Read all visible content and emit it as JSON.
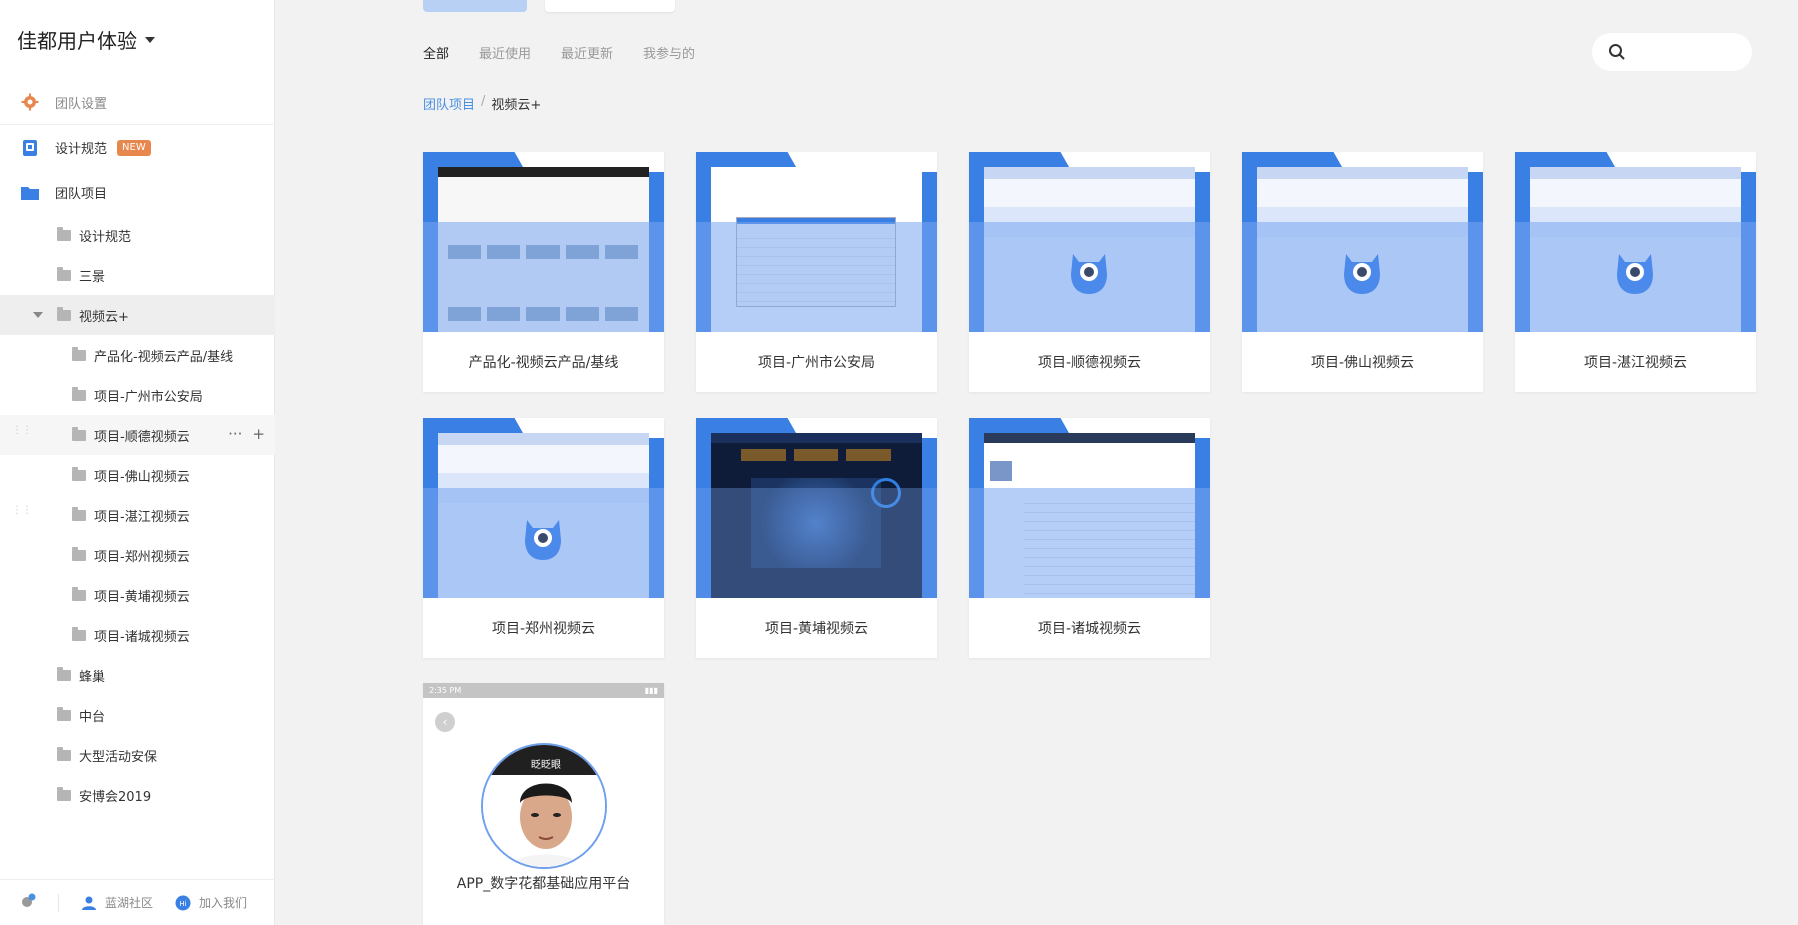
{
  "sidebar": {
    "team_title": "佳都用户体验",
    "nav": [
      {
        "label": "团队设置"
      },
      {
        "label": "设计规范",
        "badge": "NEW"
      },
      {
        "label": "团队项目"
      }
    ],
    "tree": [
      {
        "label": "设计规范"
      },
      {
        "label": "三景"
      },
      {
        "label": "视频云+"
      },
      {
        "label": "产品化-视频云产品/基线"
      },
      {
        "label": "项目-广州市公安局"
      },
      {
        "label": "项目-顺德视频云"
      },
      {
        "label": "项目-佛山视频云"
      },
      {
        "label": "项目-湛江视频云"
      },
      {
        "label": "项目-郑州视频云"
      },
      {
        "label": "项目-黄埔视频云"
      },
      {
        "label": "项目-诸城视频云"
      },
      {
        "label": "蜂巢"
      },
      {
        "label": "中台"
      },
      {
        "label": "大型活动安保"
      },
      {
        "label": "安博会2019"
      }
    ],
    "footer": {
      "community": "蓝湖社区",
      "join": "加入我们"
    }
  },
  "filters": {
    "tabs": [
      "全部",
      "最近使用",
      "最近更新",
      "我参与的"
    ],
    "active": "全部"
  },
  "search": {
    "placeholder": ""
  },
  "breadcrumb": {
    "parent": "团队项目",
    "separator": "/",
    "current": "视频云+"
  },
  "projects": [
    {
      "name": "产品化-视频云产品/基线"
    },
    {
      "name": "项目-广州市公安局"
    },
    {
      "name": "项目-顺德视频云"
    },
    {
      "name": "项目-佛山视频云"
    },
    {
      "name": "项目-湛江视频云"
    },
    {
      "name": "项目-郑州视频云"
    },
    {
      "name": "项目-黄埔视频云"
    },
    {
      "name": "项目-诸城视频云"
    }
  ],
  "app_card": {
    "time": "2:35 PM",
    "avatar_caption": "眨眨眼",
    "name": "APP_数字花都基础应用平台"
  },
  "colors": {
    "accent": "#4a90e2",
    "folder": "#3a7fe4",
    "badge": "#e7874e"
  }
}
